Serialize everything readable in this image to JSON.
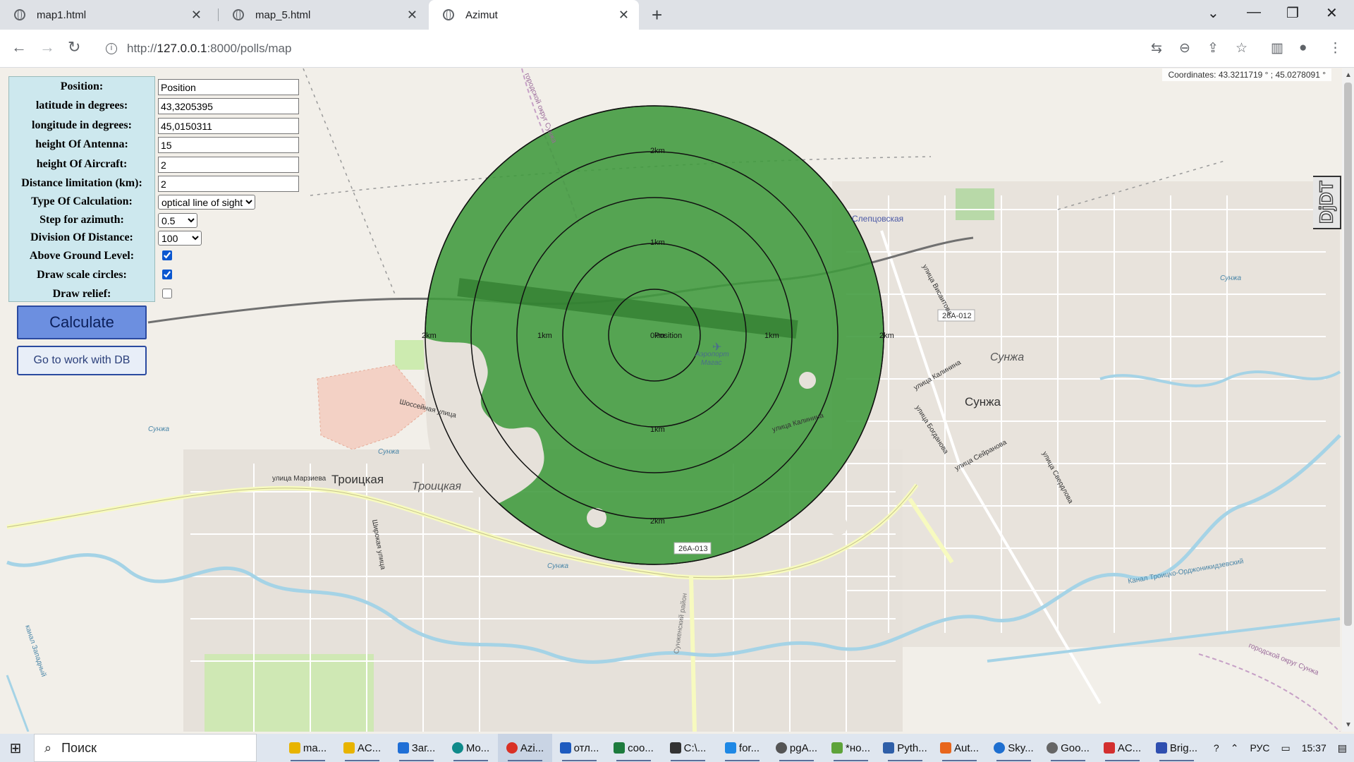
{
  "browser": {
    "tabs": [
      {
        "title": "map1.html",
        "active": false
      },
      {
        "title": "map_5.html",
        "active": false
      },
      {
        "title": "Azimut",
        "active": true
      }
    ],
    "url_prefix": "http://",
    "url_host": "127.0.0.1",
    "url_rest": ":8000/polls/map"
  },
  "map": {
    "coordinates_text": "Coordinates: 43.3211719 ° ; 45.0278091 °",
    "labels": {
      "sleptsovskaya": "Слепцовская",
      "sunzha_big": "Сунжа",
      "sunzha_italic": "Сунжа",
      "troitskaya": "Троицкая",
      "troitskaya_italic": "Троицкая",
      "airport_line1": "Аэропорт",
      "airport_line2": "Магас",
      "road_26a012": "26А-012",
      "road_26a013": "26А-013",
      "shosseynaya": "Шоссейная улица",
      "kalinina_w": "улица Калинина",
      "kalinina_e": "улица Калинина",
      "marzieva": "улица Марзиева",
      "shirokaya": "Широкая улица",
      "vysotnaya": "улица Висаитова",
      "sverdlova": "улица Свердлова",
      "seyranova": "улица Сейранова",
      "bogdanova": "улица Богданова",
      "sunzha_river_1": "Сунжа",
      "sunzha_river_2": "Сунжа",
      "sunzha_river_3": "Сунжа",
      "sunzha_river_4": "Сунжа",
      "sunzha_district": "городской округ Сунжа",
      "sunzha_district_2": "городской округ Сунжа",
      "kanal": "Канал Троицко-Орджоникидзевский",
      "kanal_zapadny": "канал Западный",
      "district_rayon": "Сунженский район"
    },
    "scale_labels": {
      "top2": "2km",
      "top1": "1km",
      "center": "0km",
      "center_overlay": "Position",
      "left2": "2km",
      "left1": "1km",
      "right1": "1km",
      "right2": "2km",
      "bottom1": "1km",
      "bottom2": "2km"
    },
    "coverage_color": "#3f9a3c"
  },
  "form": {
    "position": {
      "label": "Position:",
      "value": "Position"
    },
    "latitude": {
      "label": "latitude in degrees:",
      "value": "43,3205395"
    },
    "longitude": {
      "label": "longitude in degrees:",
      "value": "45,0150311"
    },
    "height_antenna": {
      "label": "height Of Antenna:",
      "value": "15"
    },
    "height_aircraft": {
      "label": "height Of Aircraft:",
      "value": "2"
    },
    "distance_limit": {
      "label": "Distance limitation (km):",
      "value": "2"
    },
    "calc_type": {
      "label": "Type Of Calculation:",
      "value": "optical line of sight"
    },
    "azimuth_step": {
      "label": "Step for azimuth:",
      "value": "0.5"
    },
    "division": {
      "label": "Division Of Distance:",
      "value": "100"
    },
    "above_ground": {
      "label": "Above Ground Level:",
      "checked": true
    },
    "scale_circles": {
      "label": "Draw scale circles:",
      "checked": true
    },
    "relief": {
      "label": "Draw relief:",
      "checked": false
    },
    "calculate_label": "Calculate",
    "db_label": "Go to work with DB"
  },
  "djdt_label": "DjDT",
  "taskbar": {
    "search_placeholder": "Поиск",
    "tasks": [
      {
        "label": "ma...",
        "color": "#e8b400"
      },
      {
        "label": "AC...",
        "color": "#e8b400"
      },
      {
        "label": "Заг...",
        "color": "#1f6fd6"
      },
      {
        "label": "Mo...",
        "color": "#0f8a8a"
      },
      {
        "label": "Azi...",
        "color": "#d93025"
      },
      {
        "label": "отл...",
        "color": "#1e5bbf"
      },
      {
        "label": "coo...",
        "color": "#1d7b3d"
      },
      {
        "label": "C:\\...",
        "color": "#333333"
      },
      {
        "label": "for...",
        "color": "#1e88e5"
      },
      {
        "label": "pgA...",
        "color": "#555555"
      },
      {
        "label": "*но...",
        "color": "#5ea33a"
      },
      {
        "label": "Pyth...",
        "color": "#2f5fa8"
      },
      {
        "label": "Aut...",
        "color": "#e8661c"
      },
      {
        "label": "Sky...",
        "color": "#1e6fd0"
      },
      {
        "label": "Goo...",
        "color": "#666666"
      },
      {
        "label": "AC...",
        "color": "#d32f2f"
      },
      {
        "label": "Brig...",
        "color": "#2f4fb0"
      }
    ],
    "lang": "РУС",
    "time": "15:37"
  }
}
